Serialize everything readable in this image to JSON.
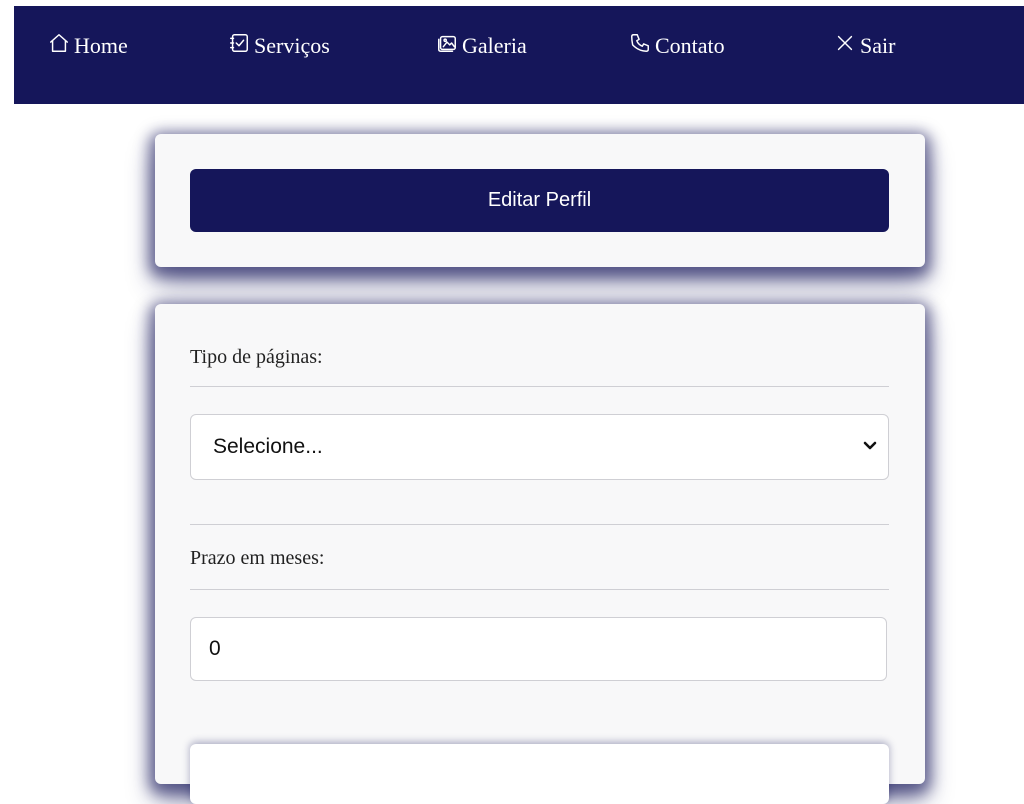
{
  "nav": {
    "items": [
      {
        "label": "Home",
        "icon": "house-icon"
      },
      {
        "label": "Serviços",
        "icon": "checklist-icon"
      },
      {
        "label": "Galeria",
        "icon": "gallery-icon"
      },
      {
        "label": "Contato",
        "icon": "phone-icon"
      },
      {
        "label": "Sair",
        "icon": "close-icon"
      }
    ]
  },
  "profile": {
    "edit_button_label": "Editar Perfil"
  },
  "form": {
    "tipo_label": "Tipo de páginas:",
    "tipo_selected": "Selecione...",
    "prazo_label": "Prazo em meses:",
    "prazo_value": "0"
  },
  "colors": {
    "primary": "#15165a",
    "card_bg": "#f8f8f9",
    "border": "#cfcfd4"
  }
}
